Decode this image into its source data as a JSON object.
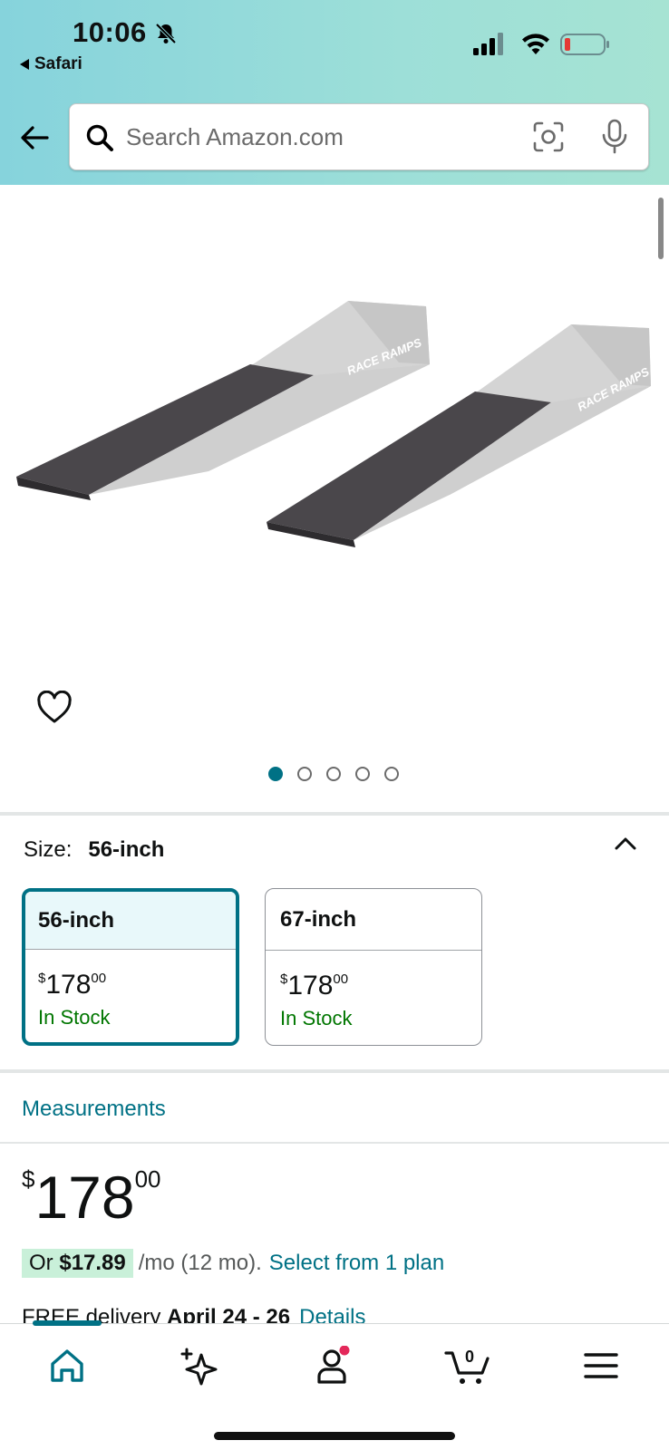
{
  "status_bar": {
    "time": "10:06",
    "back_app": "Safari"
  },
  "search": {
    "placeholder": "Search Amazon.com"
  },
  "gallery": {
    "page_count": 5,
    "active_index": 0
  },
  "size": {
    "label": "Size:",
    "selected_value": "56-inch",
    "options": [
      {
        "name": "56-inch",
        "price_symbol": "$",
        "price_whole": "178",
        "price_fraction": "00",
        "availability": "In Stock",
        "selected": true
      },
      {
        "name": "67-inch",
        "price_symbol": "$",
        "price_whole": "178",
        "price_fraction": "00",
        "availability": "In Stock",
        "selected": false
      }
    ]
  },
  "measurements_link": "Measurements",
  "price": {
    "symbol": "$",
    "whole": "178",
    "fraction": "00"
  },
  "installment": {
    "prefix": "Or",
    "amount": "$17.89",
    "terms": "/mo (12 mo).",
    "link": "Select from 1 plan"
  },
  "delivery": {
    "prefix": "FREE delivery",
    "dates": "April 24 - 26",
    "link": "Details"
  },
  "bottom_nav": {
    "cart_count": "0",
    "items": [
      "home-icon",
      "sparkle-icon",
      "account-icon",
      "cart-icon",
      "menu-icon"
    ]
  },
  "colors": {
    "accent": "#007185",
    "in_stock": "#007600",
    "deal_pill": "#c9f0d9",
    "header_start": "#86d3dc",
    "header_end": "#a6e3d3",
    "notification_dot": "#e3285a"
  }
}
